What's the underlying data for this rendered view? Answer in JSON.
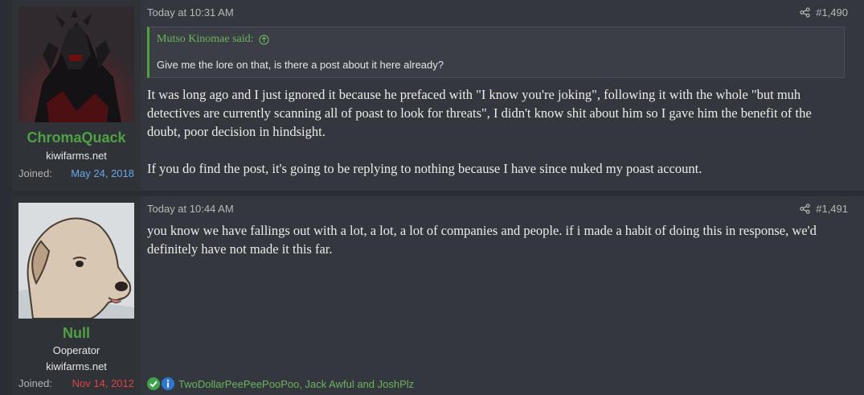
{
  "posts": [
    {
      "user": {
        "username": "ChromaQuack",
        "lines": [
          "kiwifarms.net"
        ],
        "joined_label": "Joined:",
        "joined_date": "May 24, 2018",
        "joined_color": "#6aa6e6",
        "username_color": "#4fa144",
        "avatar_icon": "dark-armored-knight-avatar"
      },
      "timestamp": "Today at 10:31 AM",
      "post_number": "#1,490",
      "quote": {
        "author_label": "Mutso Kinomae said:",
        "text": "Give me the lore on that, is there a post about it here already?"
      },
      "paragraphs": [
        "It was long ago and I just ignored it because he prefaced with \"I know you're joking\", following it with the whole \"but muh detectives are currently scanning all of poast to look for threats\", I didn't know shit about him so I gave him the benefit of the doubt, poor decision in hindsight.",
        "If you do find the post, it's going to be replying to nothing because I have since nuked my poast account."
      ]
    },
    {
      "user": {
        "username": "Null",
        "lines": [
          "Ooperator",
          "kiwifarms.net"
        ],
        "joined_label": "Joined:",
        "joined_date": "Nov 14, 2012",
        "joined_color": "#e04444",
        "username_color": "#4fa144",
        "avatar_icon": "cartoon-dog-avatar"
      },
      "timestamp": "Today at 10:44 AM",
      "post_number": "#1,491",
      "paragraphs": [
        "you know we have fallings out with a lot, a lot, a lot of companies and people. if i made a habit of doing this in response, we'd definitely have not made it this far."
      ],
      "reactions": {
        "icons": [
          "checkmark-reaction-icon",
          "informative-reaction-icon"
        ],
        "users_text": "TwoDollarPeePeePooPoo, Jack Awful and JoshPlz"
      }
    }
  ],
  "colors": {
    "accent_green": "#4fa144",
    "background": "#2a2d33",
    "post_background": "#34373d"
  }
}
